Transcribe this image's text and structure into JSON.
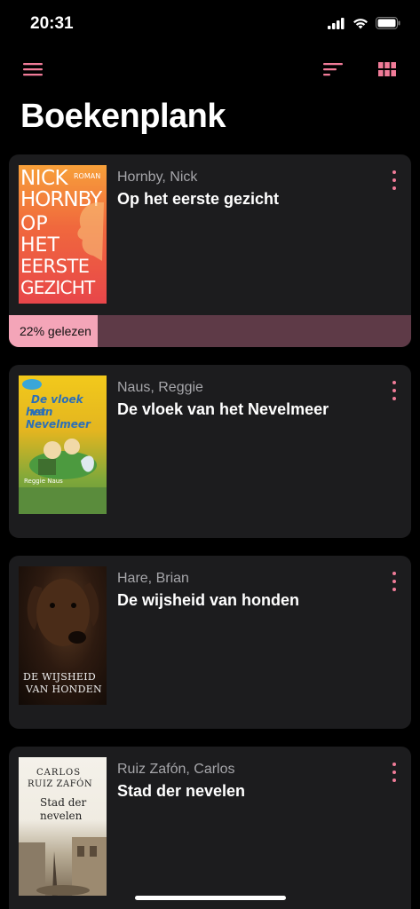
{
  "status_bar": {
    "time": "20:31"
  },
  "toolbar": {
    "menu_icon": "hamburger-icon",
    "sort_icon": "sort-icon",
    "grid_icon": "grid-icon",
    "accent": "#f07b98"
  },
  "page": {
    "title": "Boekenplank"
  },
  "books": [
    {
      "author": "Hornby, Nick",
      "title": "Op het eerste gezicht",
      "progress": {
        "label": "22% gelezen",
        "fraction": 0.22
      },
      "cover": {
        "line1": "NICK",
        "line2": "HORNBY",
        "tag": "ROMAN",
        "line3": "OP",
        "line4": "HET",
        "line5": "EERSTE",
        "line6": "GEZICHT"
      }
    },
    {
      "author": "Naus, Reggie",
      "title": "De vloek van het Nevelmeer",
      "cover": {
        "line1": "De vloek van",
        "line2": "het Nevelmeer",
        "byline": "Reggie Naus"
      }
    },
    {
      "author": "Hare, Brian",
      "title": "De wijsheid van honden",
      "cover": {
        "line1": "DE WIJSHEID",
        "line2": "VAN HONDEN"
      }
    },
    {
      "author": "Ruiz Zafón, Carlos",
      "title": "Stad der nevelen",
      "cover": {
        "line1": "CARLOS",
        "line2": "RUIZ ZAFÓN",
        "line3": "Stad der",
        "line4": "nevelen"
      }
    }
  ]
}
